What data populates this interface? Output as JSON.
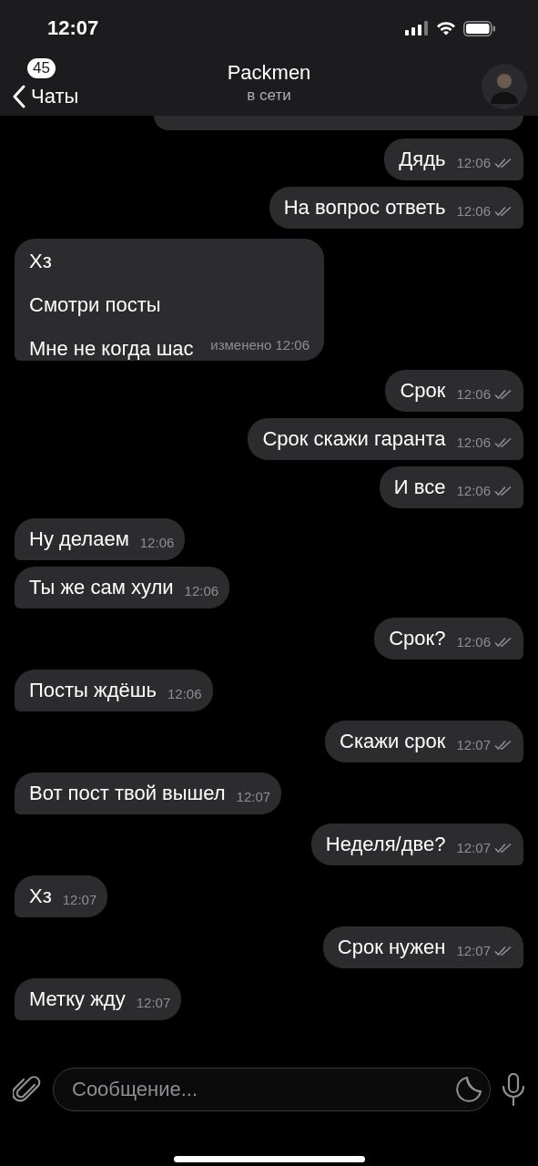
{
  "status_bar": {
    "time": "12:07"
  },
  "header": {
    "back_label": "Чаты",
    "unread_badge": "45",
    "title": "Packmen",
    "subtitle": "в сети"
  },
  "messages": [
    {
      "kind": "outgoing",
      "lines": [
        "Дядь"
      ],
      "time": "12:06",
      "read": true
    },
    {
      "kind": "outgoing",
      "lines": [
        "На вопрос ответь"
      ],
      "time": "12:06",
      "read": true
    },
    {
      "kind": "incoming",
      "lines": [
        "Хз",
        "Смотри посты",
        "Мне не когда шас"
      ],
      "edited": "изменено",
      "time": "12:06"
    },
    {
      "kind": "outgoing",
      "lines": [
        "Срок"
      ],
      "time": "12:06",
      "read": true
    },
    {
      "kind": "outgoing",
      "lines": [
        "Срок скажи гаранта"
      ],
      "time": "12:06",
      "read": true
    },
    {
      "kind": "outgoing",
      "lines": [
        "И все"
      ],
      "time": "12:06",
      "read": true
    },
    {
      "kind": "incoming",
      "lines": [
        "Ну делаем"
      ],
      "time": "12:06"
    },
    {
      "kind": "incoming",
      "lines": [
        "Ты же сам хули"
      ],
      "time": "12:06"
    },
    {
      "kind": "outgoing",
      "lines": [
        "Срок?"
      ],
      "time": "12:06",
      "read": true
    },
    {
      "kind": "incoming",
      "lines": [
        "Посты ждёшь"
      ],
      "time": "12:06"
    },
    {
      "kind": "outgoing",
      "lines": [
        "Скажи срок"
      ],
      "time": "12:07",
      "read": true
    },
    {
      "kind": "incoming",
      "lines": [
        "Вот пост твой вышел"
      ],
      "time": "12:07"
    },
    {
      "kind": "outgoing",
      "lines": [
        "Неделя/две?"
      ],
      "time": "12:07",
      "read": true
    },
    {
      "kind": "incoming",
      "lines": [
        "Хз"
      ],
      "time": "12:07"
    },
    {
      "kind": "outgoing",
      "lines": [
        "Срок нужен"
      ],
      "time": "12:07",
      "read": true
    },
    {
      "kind": "incoming",
      "lines": [
        "Метку жду"
      ],
      "time": "12:07"
    }
  ],
  "composer": {
    "placeholder": "Сообщение..."
  }
}
